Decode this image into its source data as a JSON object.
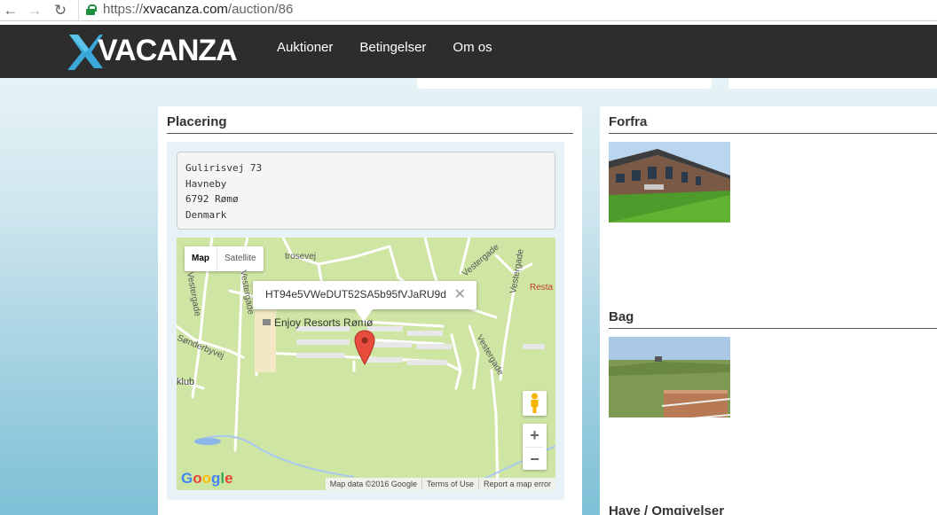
{
  "browser": {
    "back_icon": "arrow-left-icon",
    "forward_icon": "arrow-right-icon",
    "reload_icon": "reload-icon",
    "url_scheme": "https://",
    "url_host": "xvacanza.com",
    "url_path": "/auction/86"
  },
  "header": {
    "logo_text": "VACANZA",
    "nav": [
      "Auktioner",
      "Betingelser",
      "Om os"
    ]
  },
  "location": {
    "title": "Placering",
    "address_lines": [
      "Gulirisvej 73",
      "Havneby",
      "6792 Rømø",
      "Denmark"
    ]
  },
  "map": {
    "type_map": "Map",
    "type_satellite": "Satellite",
    "info_text": "HT94e5VWeDUT52SA5b95fVJaRU9d",
    "close_symbol": "✕",
    "place_label": "Enjoy Resorts Rømø",
    "club_label": "klub",
    "streets": [
      "trosevej",
      "Vestergade",
      "Vestergade",
      "Sønderbyvej",
      "Vestergade",
      "Vestergade",
      "Resta"
    ],
    "zoom_in": "+",
    "zoom_out": "−",
    "google": [
      "G",
      "o",
      "o",
      "g",
      "l",
      "e"
    ],
    "footer": [
      "Map data ©2016 Google",
      "Terms of Use",
      "Report a map error"
    ]
  },
  "gallery": {
    "front_title": "Forfra",
    "back_title": "Bag",
    "garden_title": "Have / Omgivelser"
  },
  "colors": {
    "header_bg": "#2d2d2d",
    "logo_blue": "#3aa8d8",
    "map_land": "#cfe5a4",
    "pin_red": "#e74c3c"
  }
}
